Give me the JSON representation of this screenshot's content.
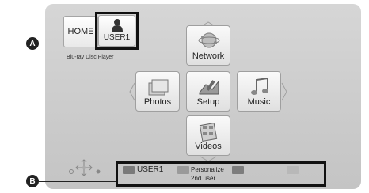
{
  "colors": {
    "screen_bg": "#cdcdcd",
    "key_red": "#7a7a7a",
    "key_green": "#9a9a9a",
    "key_yellow": "#7d7d7d",
    "key_blue": "#b8b8b8"
  },
  "header": {
    "home_label": "HOME",
    "user_label": "USER1",
    "player_name": "Blu-ray Disc Player"
  },
  "menu": {
    "network": "Network",
    "photos": "Photos",
    "setup": "Setup",
    "music": "Music",
    "videos": "Videos"
  },
  "callouts": {
    "a": "A",
    "b": "B"
  },
  "bottom_bar": {
    "user_label": "USER1",
    "personalize_line1": "Personalize",
    "personalize_line2": "2nd user"
  },
  "icons": [
    "user-icon",
    "network-globe-icon",
    "photos-icon",
    "setup-icon",
    "music-icon",
    "videos-icon",
    "navigation-cross-icon"
  ]
}
